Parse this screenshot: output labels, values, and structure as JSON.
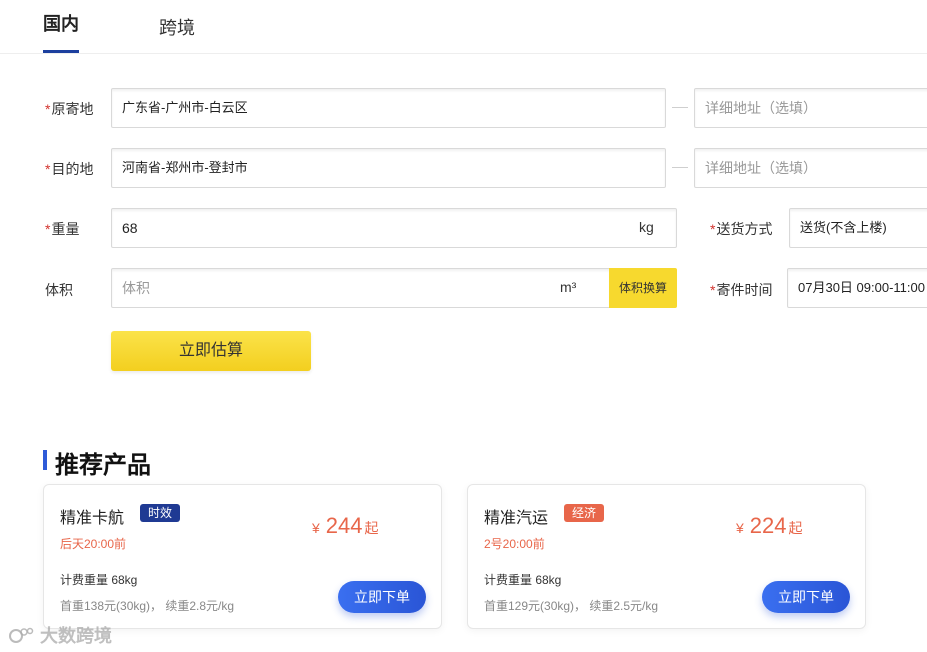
{
  "tabs": {
    "domestic": "国内",
    "international": "跨境"
  },
  "form": {
    "origin": {
      "label": "原寄地",
      "value": "广东省-广州市-白云区",
      "detail_placeholder": "详细地址（选填）"
    },
    "destination": {
      "label": "目的地",
      "value": "河南省-郑州市-登封市",
      "detail_placeholder": "详细地址（选填）"
    },
    "weight": {
      "label": "重量",
      "value": "68",
      "unit": "kg"
    },
    "delivery": {
      "label": "送货方式",
      "value": "送货(不含上楼)"
    },
    "volume": {
      "label": "体积",
      "placeholder": "体积",
      "unit": "m³",
      "convert_label": "体积换算"
    },
    "send_time": {
      "label": "寄件时间",
      "value": "07月30日 09:00-11:00"
    },
    "required_mark": "*",
    "estimate_label": "立即估算"
  },
  "recommend": {
    "title": "推荐产品",
    "products": [
      {
        "name": "精准卡航",
        "badge": "时效",
        "eta": "后天20:00前",
        "currency": "¥",
        "price": "244",
        "price_suffix": "起",
        "billing_weight": "计费重量 68kg",
        "rate": "首重138元(30kg)， 续重2.8元/kg",
        "order_label": "立即下单"
      },
      {
        "name": "精准汽运",
        "badge": "经济",
        "eta": "2号20:00前",
        "currency": "¥",
        "price": "224",
        "price_suffix": "起",
        "billing_weight": "计费重量 68kg",
        "rate": "首重129元(30kg)， 续重2.5元/kg",
        "order_label": "立即下单"
      }
    ]
  },
  "watermark": "大数跨境",
  "colors": {
    "accent_blue": "#2e5bd8",
    "tab_underline": "#1c3f9e",
    "yellow": "#f7d92e",
    "price_orange": "#e8664a",
    "required_red": "#d2322d"
  }
}
